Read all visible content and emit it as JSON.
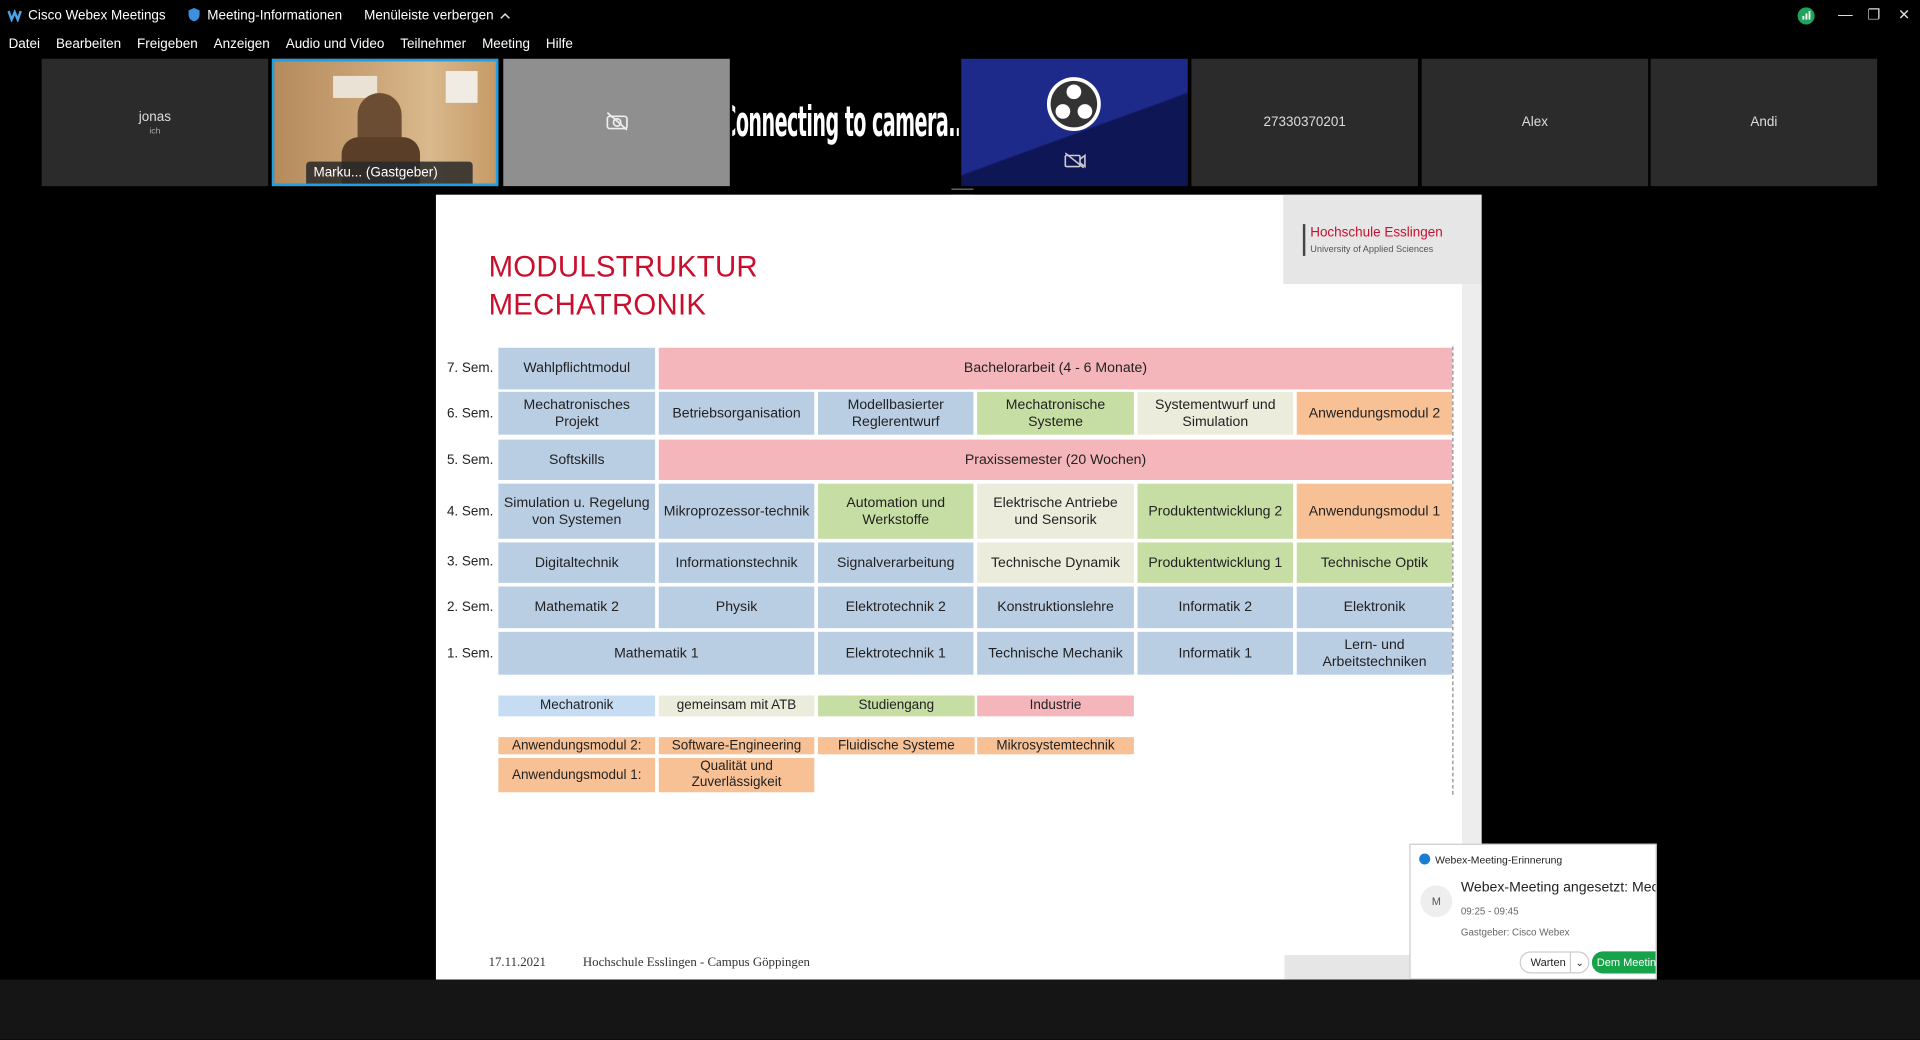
{
  "titlebar": {
    "app_name": "Cisco Webex Meetings",
    "meeting_info": "Meeting-Informationen",
    "hide_menu": "Menüleiste verbergen"
  },
  "menu": [
    "Datei",
    "Bearbeiten",
    "Freigeben",
    "Anzeigen",
    "Audio und Video",
    "Teilnehmer",
    "Meeting",
    "Hilfe"
  ],
  "participants": [
    {
      "name": "jonas",
      "sub": "ich"
    },
    {
      "name": "Marku...  (Gastgeber)"
    },
    {
      "name": ""
    },
    {
      "name": "Connecting to camera..."
    },
    {
      "name": ""
    },
    {
      "name": "27330370201"
    },
    {
      "name": "Alex"
    },
    {
      "name": "Andi"
    }
  ],
  "slide": {
    "title_line1": "MODULSTRUKTUR",
    "title_line2": "MECHATRONIK",
    "logo_name": "Hochschule Esslingen",
    "logo_sub": "University of Applied Sciences",
    "semesters": [
      "7. Sem.",
      "6. Sem.",
      "5. Sem.",
      "4. Sem.",
      "3. Sem.",
      "2. Sem.",
      "1. Sem."
    ],
    "cells": {
      "r7": [
        "Wahlpflichtmodul",
        "Bachelorarbeit (4 - 6 Monate)"
      ],
      "r6": [
        "Mechatronisches Projekt",
        "Betriebsorganisation",
        "Modellbasierter Reglerentwurf",
        "Mechatronische Systeme",
        "Systementwurf und Simulation",
        "Anwendungsmodul 2"
      ],
      "r5": [
        "Softskills",
        "Praxissemester (20 Wochen)"
      ],
      "r4": [
        "Simulation u. Regelung von Systemen",
        "Mikroprozessor-technik",
        "Automation und Werkstoffe",
        "Elektrische Antriebe und Sensorik",
        "Produktentwicklung 2",
        "Anwendungsmodul 1"
      ],
      "r3": [
        "Digitaltechnik",
        "Informationstechnik",
        "Signalverarbeitung",
        "Technische Dynamik",
        "Produktentwicklung 1",
        "Technische Optik"
      ],
      "r2": [
        "Mathematik 2",
        "Physik",
        "Elektrotechnik 2",
        "Konstruktionslehre",
        "Informatik 2",
        "Elektronik"
      ],
      "r1": [
        "Mathematik 1",
        "Elektrotechnik 1",
        "Technische Mechanik",
        "Informatik 1",
        "Lern- und Arbeitstechniken"
      ]
    },
    "legend": [
      "Mechatronik",
      "gemeinsam mit ATB",
      "Studiengang",
      "Industrie"
    ],
    "am2": [
      "Anwendungsmodul 2:",
      "Software-Engineering",
      "Fluidische Systeme",
      "Mikrosystemtechnik"
    ],
    "am1": [
      "Anwendungsmodul 1:",
      "Qualität und Zuverlässigkeit"
    ],
    "footer_date": "17.11.2021",
    "footer_text": "Hochschule Esslingen -  Campus Göppingen"
  },
  "notification": {
    "app": "Webex-Meeting-Erinnerung",
    "avatar": "M",
    "subject": "Webex-Meeting angesetzt: Mec",
    "time": "09:25 - 09:45",
    "host": "Gastgeber: Cisco Webex",
    "snooze": "Warten",
    "join": "Dem Meeting"
  },
  "colors": {
    "accent_red": "#c8102e",
    "mechatronik": "#b9cde3",
    "atb": "#ececdc",
    "studiengang": "#c6dea3",
    "industrie": "#f4b6bb",
    "anwendung": "#f7c195",
    "active_speaker_border": "#1ea0e6"
  }
}
